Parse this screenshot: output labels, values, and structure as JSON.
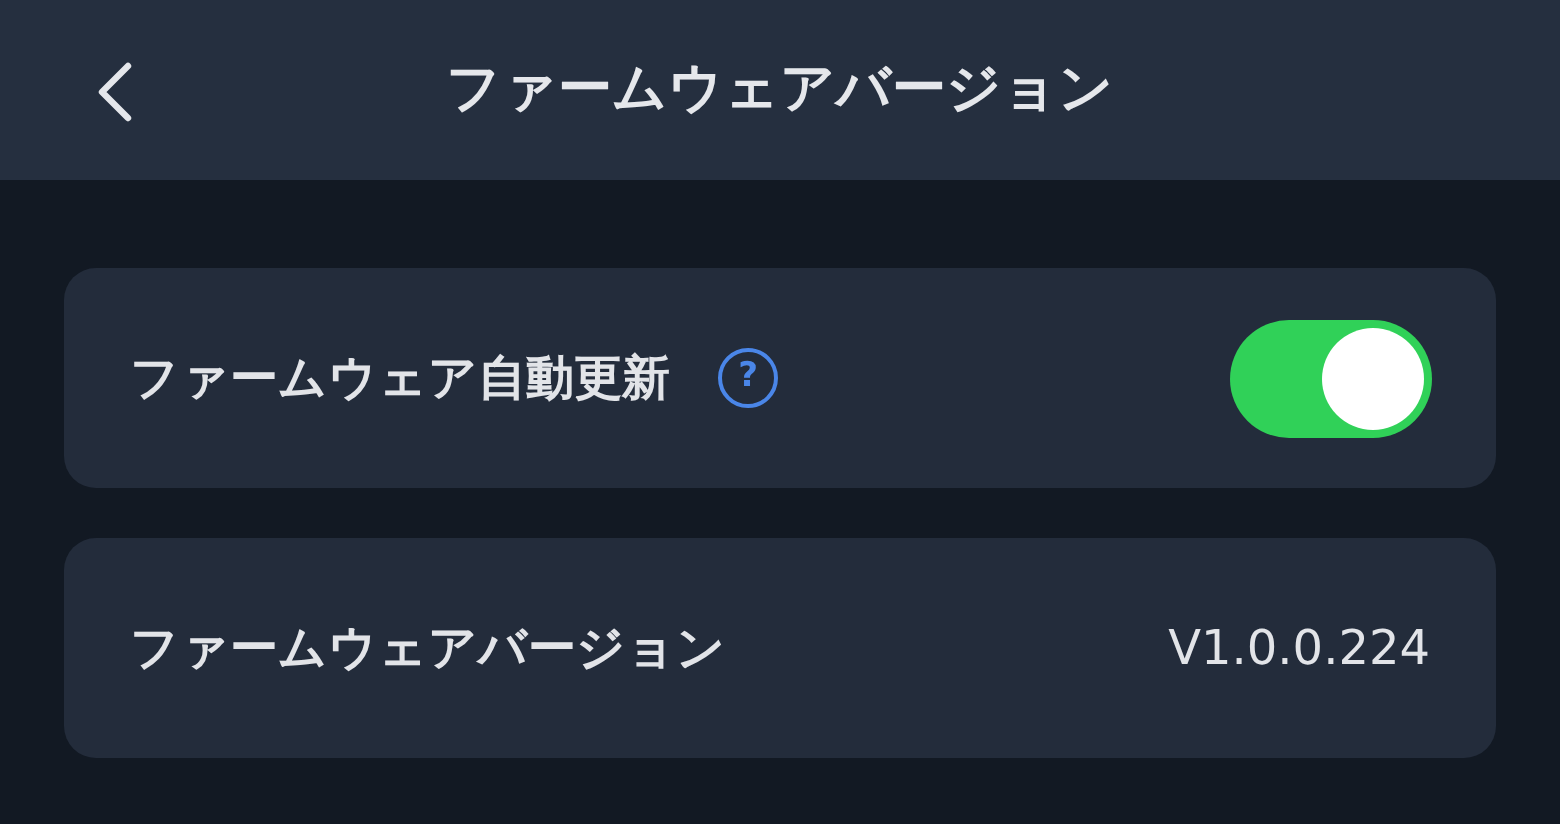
{
  "header": {
    "title": "ファームウェアバージョン"
  },
  "settings": [
    {
      "kind": "toggle",
      "label": "ファームウェア自動更新",
      "help": "?",
      "on": true
    },
    {
      "kind": "value",
      "label": "ファームウェアバージョン",
      "value": "V1.0.0.224"
    }
  ]
}
